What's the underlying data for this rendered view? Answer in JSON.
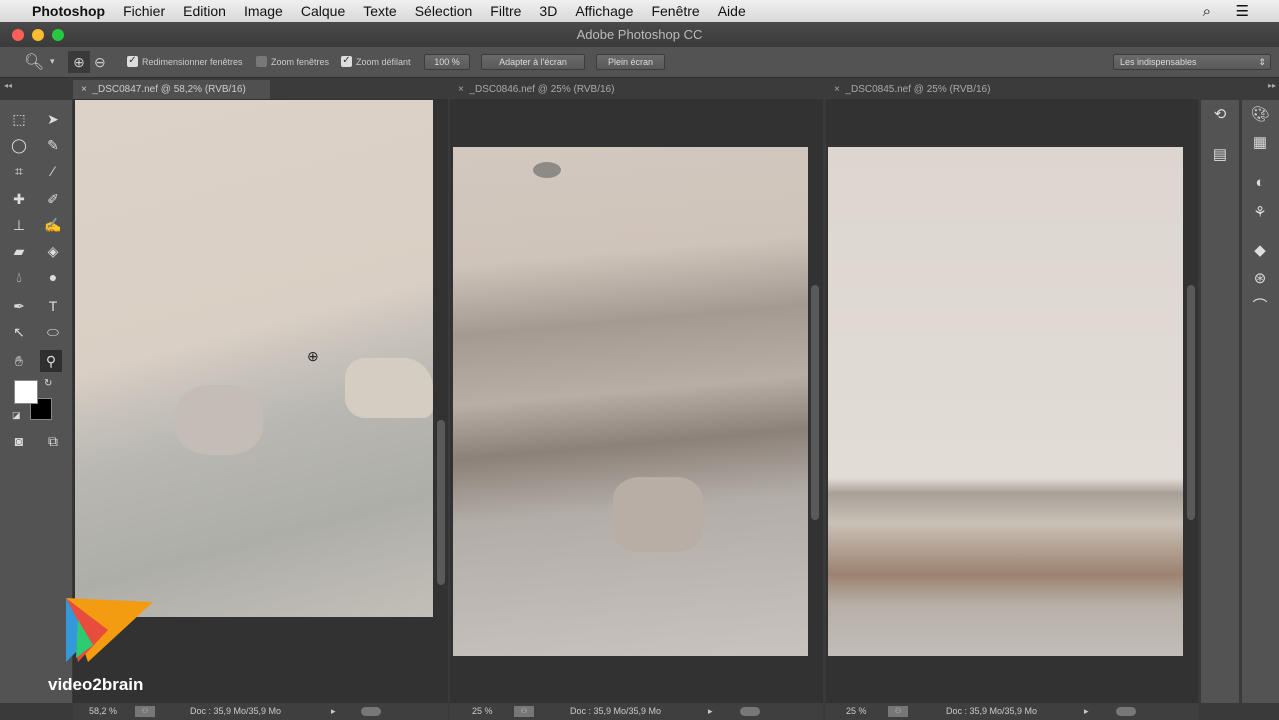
{
  "menubar": {
    "app": "Photoshop",
    "items": [
      "Fichier",
      "Edition",
      "Image",
      "Calque",
      "Texte",
      "Sélection",
      "Filtre",
      "3D",
      "Affichage",
      "Fenêtre",
      "Aide"
    ]
  },
  "window": {
    "title": "Adobe Photoshop CC"
  },
  "options": {
    "resize_windows": "Redimensionner fenêtres",
    "resize_checked": true,
    "zoom_all": "Zoom fenêtres",
    "zoom_all_checked": false,
    "scrubby": "Zoom défilant",
    "scrubby_checked": true,
    "zoom100": "100 %",
    "fit": "Adapter à l'écran",
    "fill": "Plein écran",
    "workspace": "Les indispensables"
  },
  "documents": [
    {
      "tab": "_DSC0847.nef @ 58,2% (RVB/16)",
      "zoom": "58,2 %",
      "doc": "Doc : 35,9 Mo/35,9 Mo",
      "active": true
    },
    {
      "tab": "_DSC0846.nef @ 25% (RVB/16)",
      "zoom": "25 %",
      "doc": "Doc : 35,9 Mo/35,9 Mo",
      "active": false
    },
    {
      "tab": "_DSC0845.nef @ 25% (RVB/16)",
      "zoom": "25 %",
      "doc": "Doc : 35,9 Mo/35,9 Mo",
      "active": false
    }
  ],
  "close_glyph": "×",
  "watermark": "video2brain",
  "colors": {
    "foreground": "#ffffff",
    "background": "#000000"
  }
}
